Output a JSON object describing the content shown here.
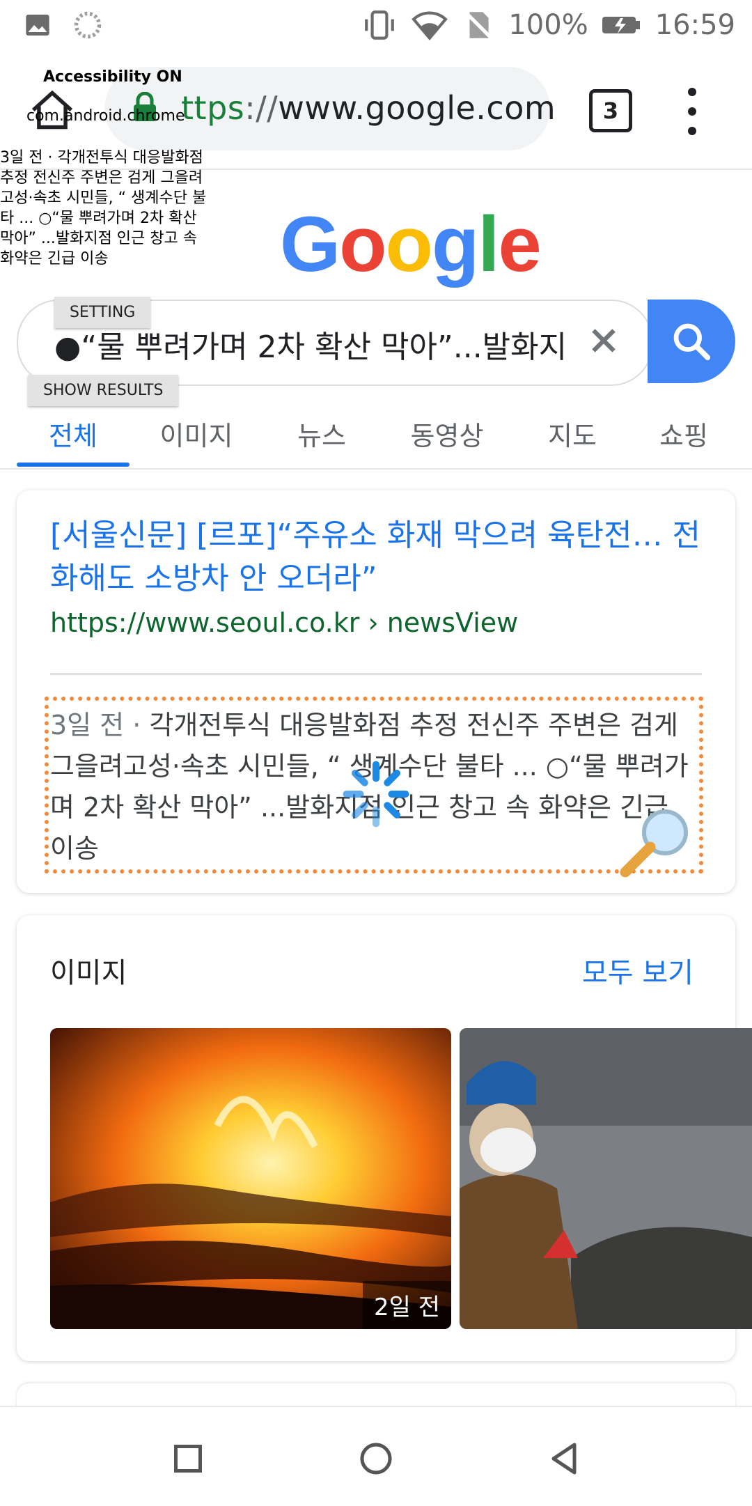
{
  "status_bar": {
    "battery": "100%",
    "time": "16:59",
    "icons": [
      "image-icon",
      "sync-icon",
      "vibrate-icon",
      "wifi-icon",
      "no-sim-icon",
      "battery-icon"
    ]
  },
  "overlay": {
    "accessibility": "Accessibility ON",
    "package": "com.android.chrome",
    "snippet": "3일 전 · 각개전투식 대응발화점 추정 전신주 주변은 검게 그을려고성·속초 시민들, “ 생계수단 불타 ... ○“물 뿌려가며 2차 확산 막아” ...발화지점 인근 창고 속 화약은 긴급 이송",
    "setting_label": "SETTING",
    "show_results_label": "SHOW RESULTS"
  },
  "toolbar": {
    "url_scheme": "ttps",
    "url_sep": "://",
    "url_host": "www.google.com",
    "tab_count": "3"
  },
  "logo": [
    "G",
    "o",
    "o",
    "g",
    "l",
    "e"
  ],
  "colors": {
    "logo": [
      "#4285F4",
      "#EA4335",
      "#FBBC05",
      "#4285F4",
      "#34A853",
      "#EA4335"
    ],
    "accent": "#1a73e8",
    "url_green": "#0d652d",
    "search_button": "#4285f4",
    "focus_outline": "#f28a3a"
  },
  "search": {
    "query": "●“물 뿌려가며 2차 확산 막아”...발화지"
  },
  "tabs": [
    {
      "label": "전체",
      "active": true
    },
    {
      "label": "이미지",
      "active": false
    },
    {
      "label": "뉴스",
      "active": false
    },
    {
      "label": "동영상",
      "active": false
    },
    {
      "label": "지도",
      "active": false
    },
    {
      "label": "쇼핑",
      "active": false
    }
  ],
  "result": {
    "title": "[서울신문] [르포]“주유소 화재 막으려 육탄전… 전화해도 소방차 안 오더라”",
    "url": "https://www.seoul.co.kr › newsView",
    "date": "3일 전 · ",
    "snippet": "각개전투식 대응발화점 추정 전신주 주변은 검게 그을려고성·속초 시민들, “ 생계수단 불타 ... ○“물 뿌려가며 2차 확산 막아” ...발화지점 인근 창고 속 화약은 긴급 이송"
  },
  "images": {
    "title": "이미지",
    "see_all": "모두 보기",
    "items": [
      {
        "age": "2일 전",
        "desc": "burning-cars"
      },
      {
        "age": "",
        "desc": "firefighter-with-mask"
      }
    ]
  }
}
